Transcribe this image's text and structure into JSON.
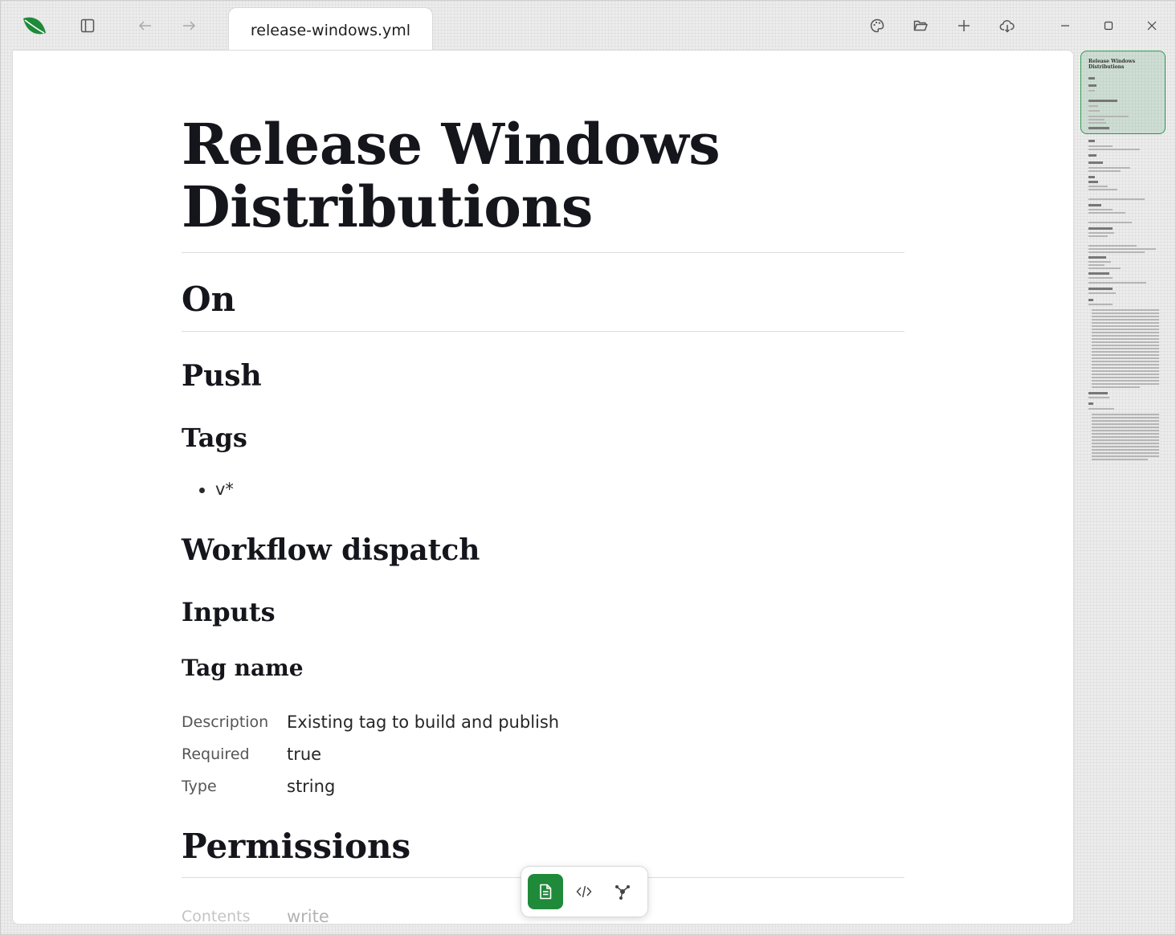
{
  "window": {
    "tab_title": "release-windows.yml"
  },
  "toolbar": {
    "left_icons": [
      "app-logo-icon",
      "sidebar-toggle-icon",
      "back-arrow-icon",
      "forward-arrow-icon"
    ],
    "right_icons": [
      "palette-icon",
      "open-folder-icon",
      "plus-icon",
      "cloud-download-icon"
    ],
    "window_controls": [
      "minimize-icon",
      "maximize-icon",
      "close-icon"
    ]
  },
  "document": {
    "title": "Release Windows Distributions",
    "title_line1": "Release Windows",
    "title_line2": "Distributions",
    "on_heading": "On",
    "push_heading": "Push",
    "tags_heading": "Tags",
    "tags": [
      "v*"
    ],
    "workflow_dispatch_heading": "Workflow dispatch",
    "inputs_heading": "Inputs",
    "tag_name_heading": "Tag name",
    "tag_name_fields": [
      {
        "key": "Description",
        "value": "Existing tag to build and publish"
      },
      {
        "key": "Required",
        "value": "true"
      },
      {
        "key": "Type",
        "value": "string"
      }
    ],
    "permissions_heading": "Permissions",
    "permissions_fields": [
      {
        "key": "Contents",
        "value": "write"
      }
    ]
  },
  "minimap": {
    "title": "Release Windows Distributions"
  },
  "view_switcher": {
    "modes": [
      "document-view-icon",
      "code-view-icon",
      "graph-view-icon"
    ],
    "active": "document-view-icon"
  },
  "colors": {
    "accent": "#1f8a3a",
    "minimap_highlight": "#2b9a50",
    "heading": "#15151c"
  }
}
